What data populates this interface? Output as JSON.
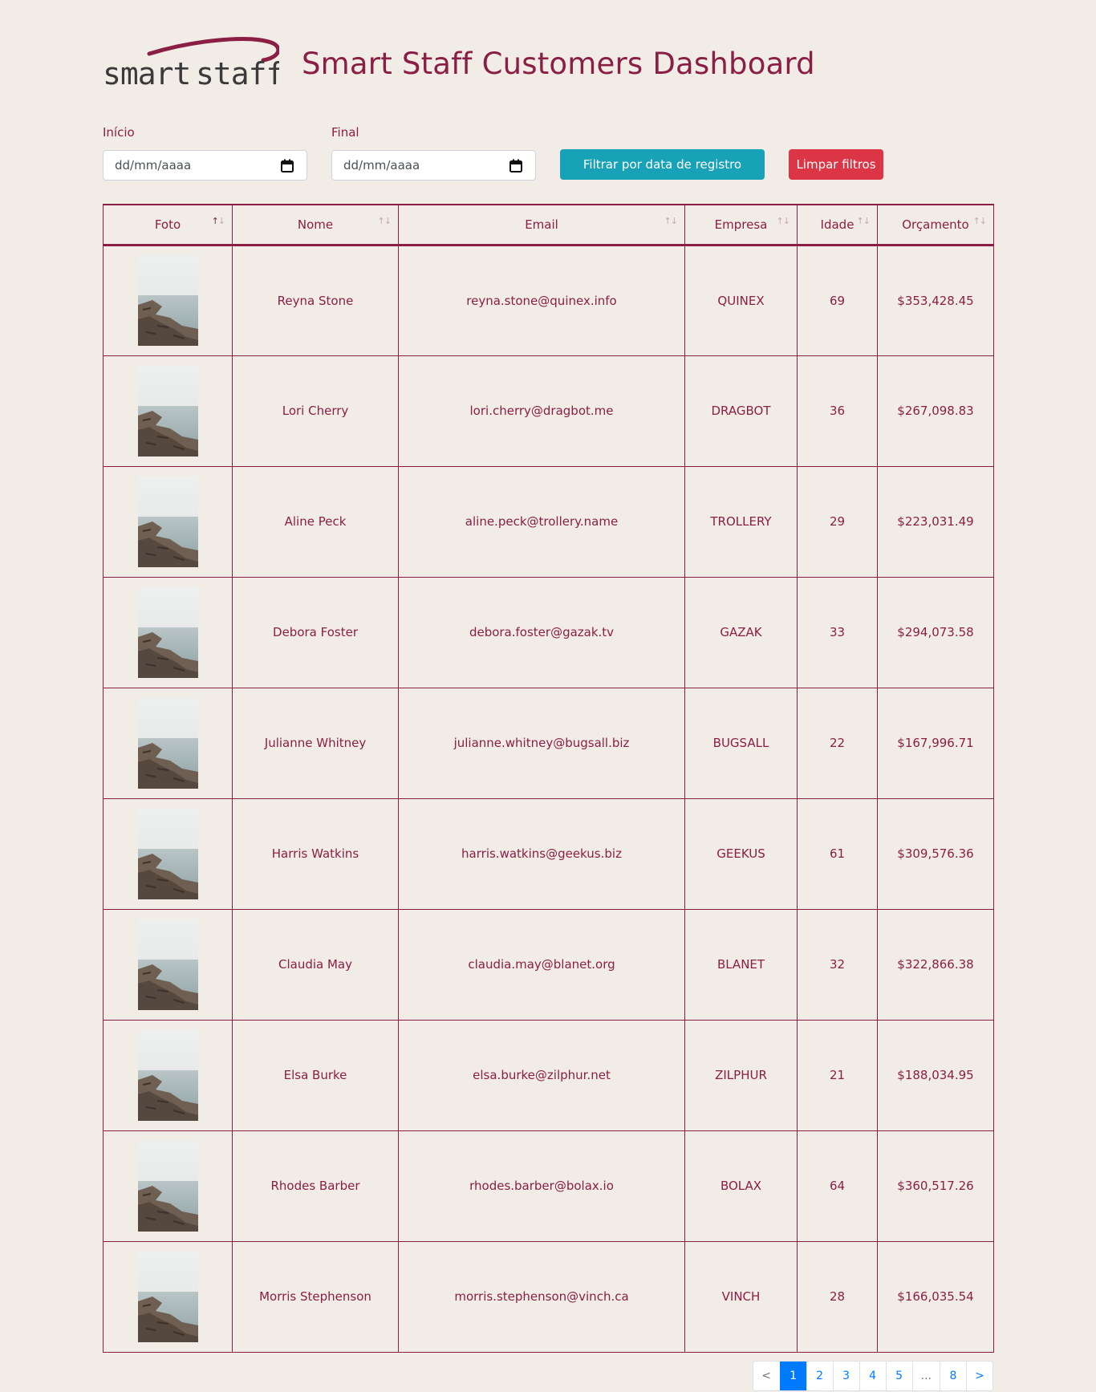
{
  "header": {
    "logo_text": "smartstaff",
    "title": "Smart Staff Customers Dashboard"
  },
  "filters": {
    "start_label": "Início",
    "start_placeholder": "dd/mm/aaaa",
    "end_label": "Final",
    "end_placeholder": "dd/mm/aaaa",
    "filter_button": "Filtrar por data de registro",
    "clear_button": "Limpar filtros"
  },
  "table": {
    "columns": [
      "Foto",
      "Nome",
      "Email",
      "Empresa",
      "Idade",
      "Orçamento"
    ],
    "rows": [
      {
        "name": "Reyna Stone",
        "email": "reyna.stone@quinex.info",
        "company": "QUINEX",
        "age": "69",
        "budget": "$353,428.45"
      },
      {
        "name": "Lori Cherry",
        "email": "lori.cherry@dragbot.me",
        "company": "DRAGBOT",
        "age": "36",
        "budget": "$267,098.83"
      },
      {
        "name": "Aline Peck",
        "email": "aline.peck@trollery.name",
        "company": "TROLLERY",
        "age": "29",
        "budget": "$223,031.49"
      },
      {
        "name": "Debora Foster",
        "email": "debora.foster@gazak.tv",
        "company": "GAZAK",
        "age": "33",
        "budget": "$294,073.58"
      },
      {
        "name": "Julianne Whitney",
        "email": "julianne.whitney@bugsall.biz",
        "company": "BUGSALL",
        "age": "22",
        "budget": "$167,996.71"
      },
      {
        "name": "Harris Watkins",
        "email": "harris.watkins@geekus.biz",
        "company": "GEEKUS",
        "age": "61",
        "budget": "$309,576.36"
      },
      {
        "name": "Claudia May",
        "email": "claudia.may@blanet.org",
        "company": "BLANET",
        "age": "32",
        "budget": "$322,866.38"
      },
      {
        "name": "Elsa Burke",
        "email": "elsa.burke@zilphur.net",
        "company": "ZILPHUR",
        "age": "21",
        "budget": "$188,034.95"
      },
      {
        "name": "Rhodes Barber",
        "email": "rhodes.barber@bolax.io",
        "company": "BOLAX",
        "age": "64",
        "budget": "$360,517.26"
      },
      {
        "name": "Morris Stephenson",
        "email": "morris.stephenson@vinch.ca",
        "company": "VINCH",
        "age": "28",
        "budget": "$166,035.54"
      }
    ]
  },
  "pagination": {
    "prev": "<",
    "pages": [
      "1",
      "2",
      "3",
      "4",
      "5"
    ],
    "ellipsis": "...",
    "last": "8",
    "next": ">",
    "active": "1"
  },
  "colors": {
    "brand": "#8b1e45",
    "background": "#f1ede6",
    "filter_button": "#17a2b8",
    "clear_button": "#dc3545",
    "pagination_active": "#007bff"
  }
}
